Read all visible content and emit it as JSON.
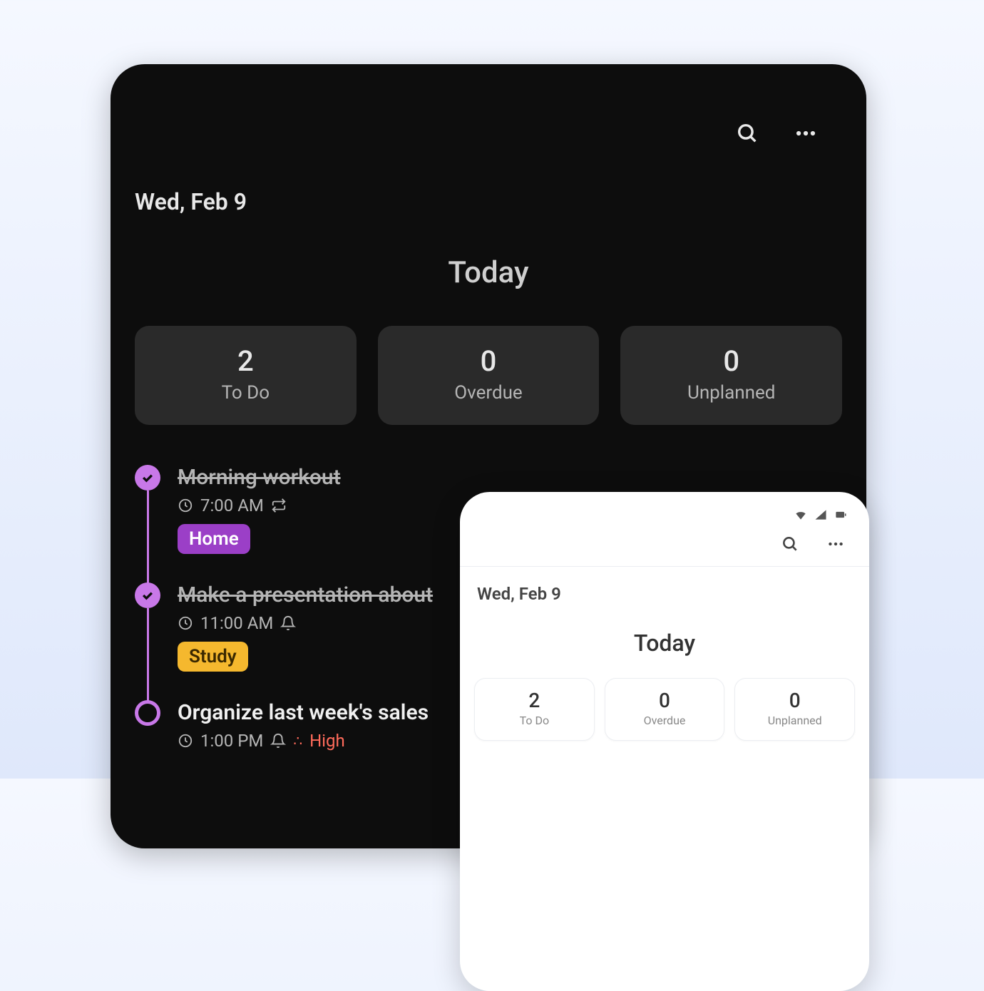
{
  "dark": {
    "date": "Wed, Feb 9",
    "heading": "Today",
    "stats": [
      {
        "value": "2",
        "label": "To Do"
      },
      {
        "value": "0",
        "label": "Overdue"
      },
      {
        "value": "0",
        "label": "Unplanned"
      }
    ],
    "tasks": [
      {
        "title": "Morning workout",
        "done": true,
        "time": "7:00 AM",
        "repeat": true,
        "tag": {
          "text": "Home",
          "style": "home"
        }
      },
      {
        "title": "Make a presentation about",
        "done": true,
        "time": "11:00 AM",
        "reminder": true,
        "tag": {
          "text": "Study",
          "style": "study"
        }
      },
      {
        "title": "Organize last week's sales",
        "done": false,
        "time": "1:00 PM",
        "reminder": true,
        "priority": "High"
      }
    ]
  },
  "light": {
    "date": "Wed, Feb 9",
    "heading": "Today",
    "stats": [
      {
        "value": "2",
        "label": "To Do"
      },
      {
        "value": "0",
        "label": "Overdue"
      },
      {
        "value": "0",
        "label": "Unplanned"
      }
    ]
  }
}
